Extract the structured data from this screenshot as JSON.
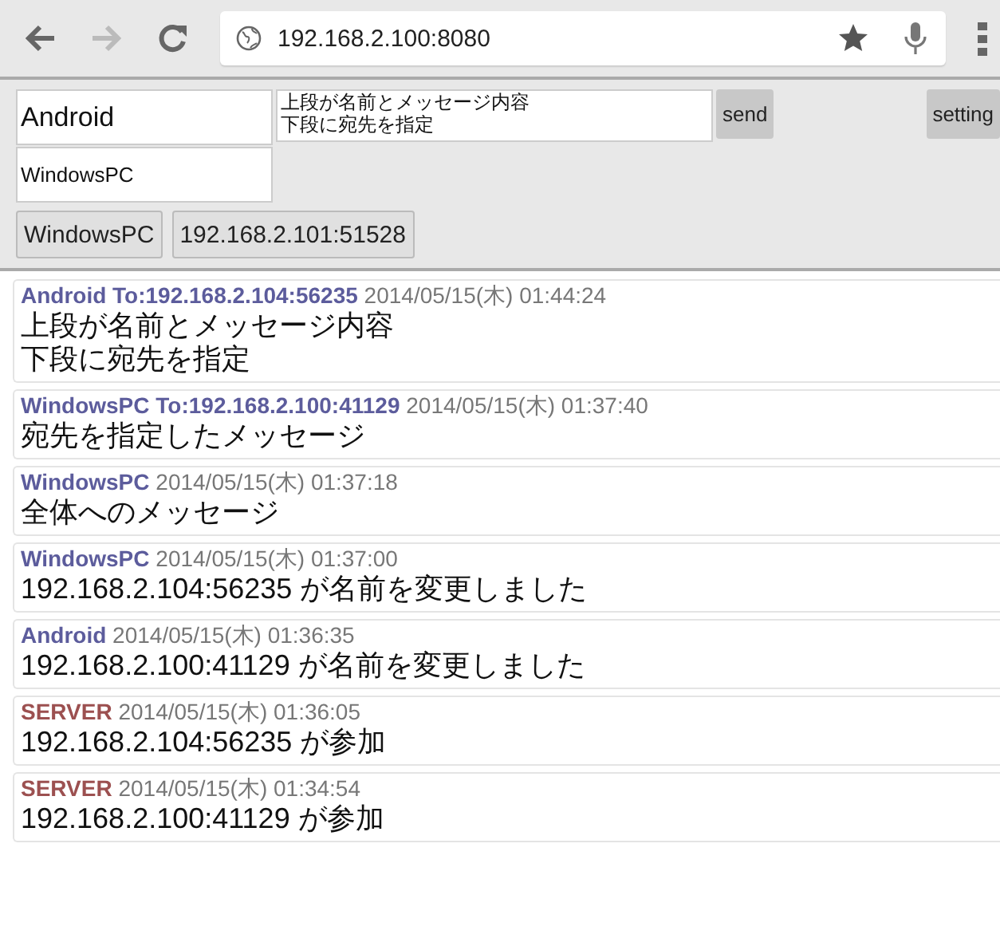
{
  "browser": {
    "url": "192.168.2.100:8080"
  },
  "form": {
    "name": "Android",
    "message_lines": [
      "上段が名前とメッセージ内容",
      "下段に宛先を指定"
    ],
    "send": "send",
    "setting": "setting",
    "destination": "WindowsPC",
    "recipients": [
      "WindowsPC",
      "192.168.2.101:51528"
    ]
  },
  "messages": [
    {
      "sender": "Android To:192.168.2.104:56235",
      "color": "#5c5c9c",
      "time": "2014/05/15(木) 01:44:24",
      "lines": [
        "上段が名前とメッセージ内容",
        "下段に宛先を指定"
      ]
    },
    {
      "sender": "WindowsPC To:192.168.2.100:41129",
      "color": "#5c5c9c",
      "time": "2014/05/15(木) 01:37:40",
      "lines": [
        "宛先を指定したメッセージ"
      ]
    },
    {
      "sender": "WindowsPC",
      "color": "#5c5c9c",
      "time": "2014/05/15(木) 01:37:18",
      "lines": [
        "全体へのメッセージ"
      ]
    },
    {
      "sender": "WindowsPC",
      "color": "#5c5c9c",
      "time": "2014/05/15(木) 01:37:00",
      "lines": [
        "192.168.2.104:56235 が名前を変更しました"
      ]
    },
    {
      "sender": "Android",
      "color": "#5c5c9c",
      "time": "2014/05/15(木) 01:36:35",
      "lines": [
        "192.168.2.100:41129 が名前を変更しました"
      ]
    },
    {
      "sender": "SERVER",
      "color": "#9c5050",
      "time": "2014/05/15(木) 01:36:05",
      "lines": [
        "192.168.2.104:56235 が参加"
      ]
    },
    {
      "sender": "SERVER",
      "color": "#9c5050",
      "time": "2014/05/15(木) 01:34:54",
      "lines": [
        "192.168.2.100:41129 が参加"
      ]
    }
  ]
}
